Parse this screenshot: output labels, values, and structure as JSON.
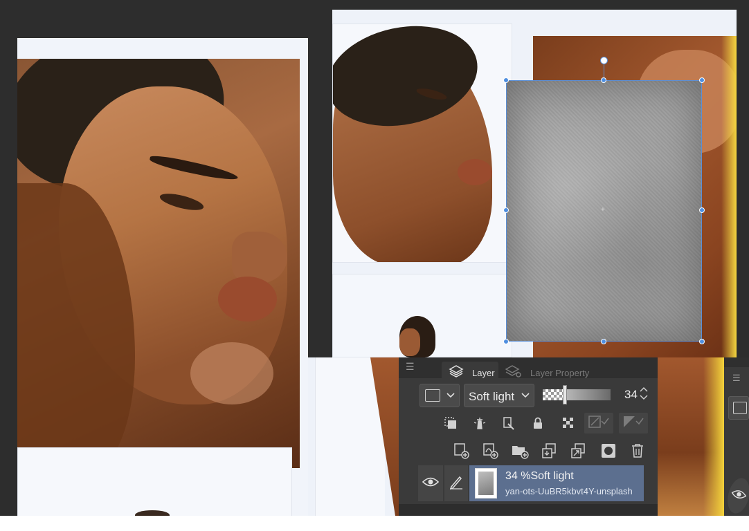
{
  "layer_panel": {
    "tabs": [
      {
        "label": "Layer",
        "icon": "layers-icon",
        "active": true
      },
      {
        "label": "Layer Property",
        "icon": "layer-property-icon",
        "active": false
      }
    ],
    "blend_mode": "Soft light",
    "opacity": "34",
    "row2_tools": [
      "clip-to-layer-icon",
      "reference-layer-icon",
      "draft-layer-icon",
      "lock-icon",
      "lock-transparent-icon",
      "mask-disabled-icon",
      "mask-disabled-icon"
    ],
    "row3_tools": [
      "new-raster-layer-icon",
      "new-vector-layer-icon",
      "new-folder-icon",
      "transfer-to-lower-icon",
      "combine-down-icon",
      "layer-mask-icon",
      "trash-icon"
    ],
    "layers": [
      {
        "title": "34 %Soft light",
        "name": "yan-ots-UuBR5kbvt4Y-unsplash",
        "visible": true,
        "selected": true
      }
    ]
  },
  "colors": {
    "panel_bg": "#3a3a3a",
    "selected_layer": "#5c6f8f",
    "selection_handle": "#4f8fe0"
  }
}
